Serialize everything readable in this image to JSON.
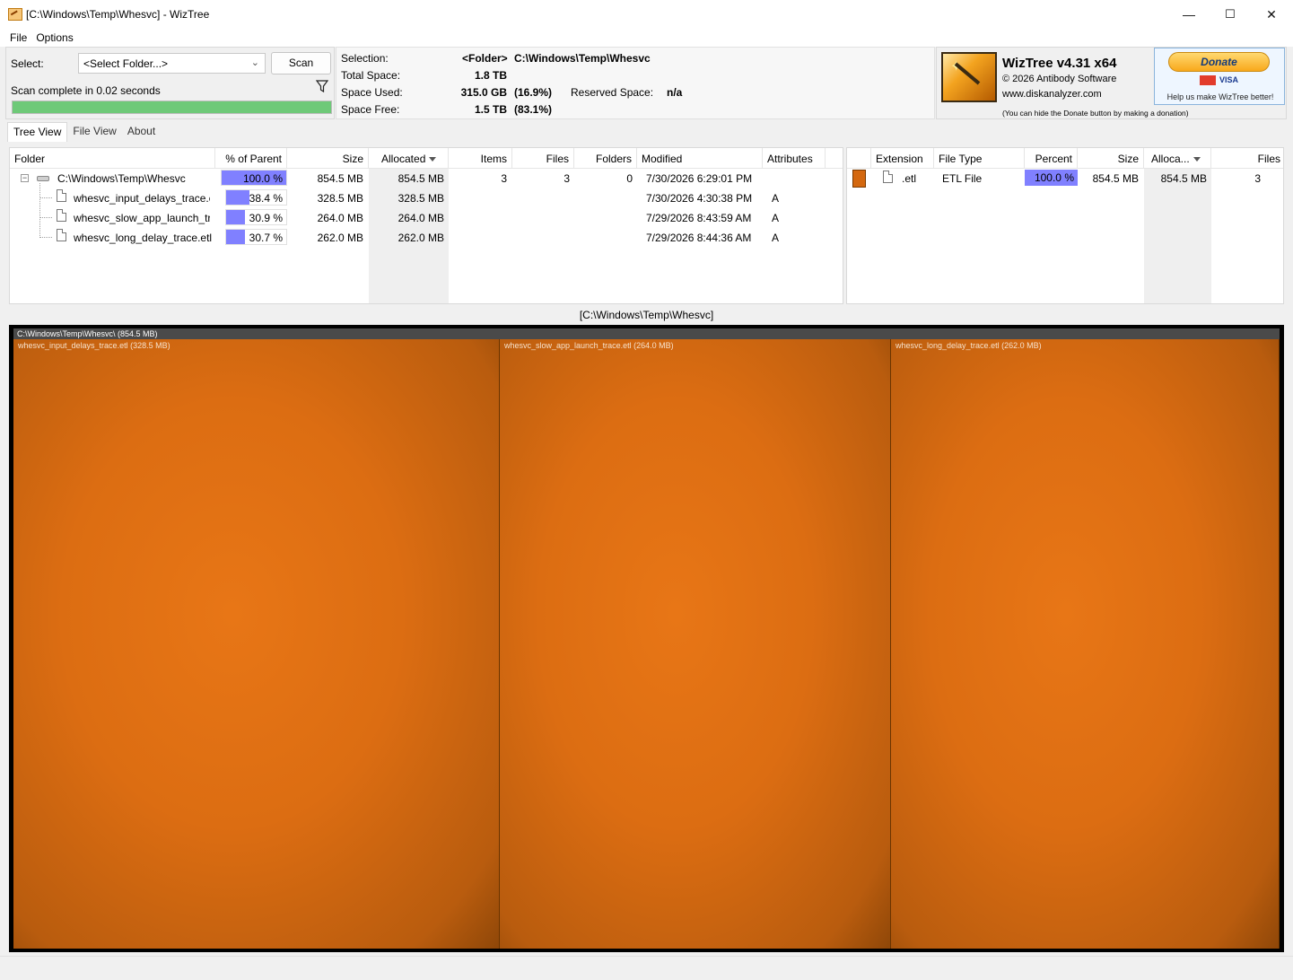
{
  "window": {
    "title": "[C:\\Windows\\Temp\\Whesvc]  - WizTree",
    "controls": {
      "minimize": "—",
      "maximize": "☐",
      "close": "✕"
    }
  },
  "menu": [
    "File",
    "Options"
  ],
  "select_panel": {
    "select_label": "Select:",
    "folder_combo": "<Select Folder...>",
    "scan_button": "Scan",
    "status": "Scan complete in 0.02 seconds",
    "progress_fraction": 1.0,
    "progress_color": "#6ec978"
  },
  "info": {
    "selection_label": "Selection:",
    "selection_type": "<Folder>",
    "selection_path": "C:\\Windows\\Temp\\Whesvc",
    "total_space_label": "Total Space:",
    "total_space": "1.8 TB",
    "space_used_label": "Space Used:",
    "space_used": "315.0 GB",
    "space_used_pct": "(16.9%)",
    "reserved_label": "Reserved Space:",
    "reserved_value": "n/a",
    "space_free_label": "Space Free:",
    "space_free": "1.5 TB",
    "space_free_pct": "(83.1%)"
  },
  "brand": {
    "name": "WizTree v4.31 x64",
    "copyright": "© 2026 Antibody Software",
    "website": "www.diskanalyzer.com",
    "donate_button": "Donate",
    "card_mc": "",
    "card_visa": "VISA",
    "donate_help": "Help us make WizTree better!",
    "hide_note": "(You can hide the Donate button by making a donation)"
  },
  "tabs": [
    "Tree View",
    "File View",
    "About"
  ],
  "tree": {
    "headers": {
      "folder": "Folder",
      "pct_parent": "% of Parent",
      "size": "Size",
      "allocated": "Allocated",
      "items": "Items",
      "files": "Files",
      "folders": "Folders",
      "modified": "Modified",
      "attributes": "Attributes"
    },
    "rows": [
      {
        "name": "C:\\Windows\\Temp\\Whesvc",
        "pct": 100.0,
        "pct_text": "100.0 %",
        "size": "854.5 MB",
        "allocated": "854.5 MB",
        "items": "3",
        "files": "3",
        "folders": "0",
        "modified": "7/30/2026 6:29:01 PM",
        "attributes": ""
      },
      {
        "name": "whesvc_input_delays_trace.etl",
        "pct": 38.4,
        "pct_text": "38.4 %",
        "size": "328.5 MB",
        "allocated": "328.5 MB",
        "items": "",
        "files": "",
        "folders": "",
        "modified": "7/30/2026 4:30:38 PM",
        "attributes": "A"
      },
      {
        "name": "whesvc_slow_app_launch_trace.etl",
        "pct": 30.9,
        "pct_text": "30.9 %",
        "size": "264.0 MB",
        "allocated": "264.0 MB",
        "items": "",
        "files": "",
        "folders": "",
        "modified": "7/29/2026 8:43:59 AM",
        "attributes": "A"
      },
      {
        "name": "whesvc_long_delay_trace.etl",
        "pct": 30.7,
        "pct_text": "30.7 %",
        "size": "262.0 MB",
        "allocated": "262.0 MB",
        "items": "",
        "files": "",
        "folders": "",
        "modified": "7/29/2026 8:44:36 AM",
        "attributes": "A"
      }
    ],
    "bar_color": "#8080ff"
  },
  "filetypes": {
    "headers": {
      "extension": "Extension",
      "file_type": "File Type",
      "percent": "Percent",
      "size": "Size",
      "allocated": "Alloca...",
      "files": "Files"
    },
    "rows": [
      {
        "color": "#d4680f",
        "extension": ".etl",
        "file_type": "ETL File",
        "pct": 100.0,
        "pct_text": "100.0 %",
        "size": "854.5 MB",
        "allocated": "854.5 MB",
        "files": "3"
      }
    ]
  },
  "treemap": {
    "title": "[C:\\Windows\\Temp\\Whesvc]",
    "root_label": "C:\\Windows\\Temp\\Whesvc\\ (854.5 MB)",
    "blocks": [
      {
        "label": "whesvc_input_delays_trace.etl (328.5 MB)",
        "size_mb": 328.5
      },
      {
        "label": "whesvc_slow_app_launch_trace.etl (264.0 MB)",
        "size_mb": 264.0
      },
      {
        "label": "whesvc_long_delay_trace.etl (262.0 MB)",
        "size_mb": 262.0
      }
    ],
    "color": "#e0700f"
  }
}
